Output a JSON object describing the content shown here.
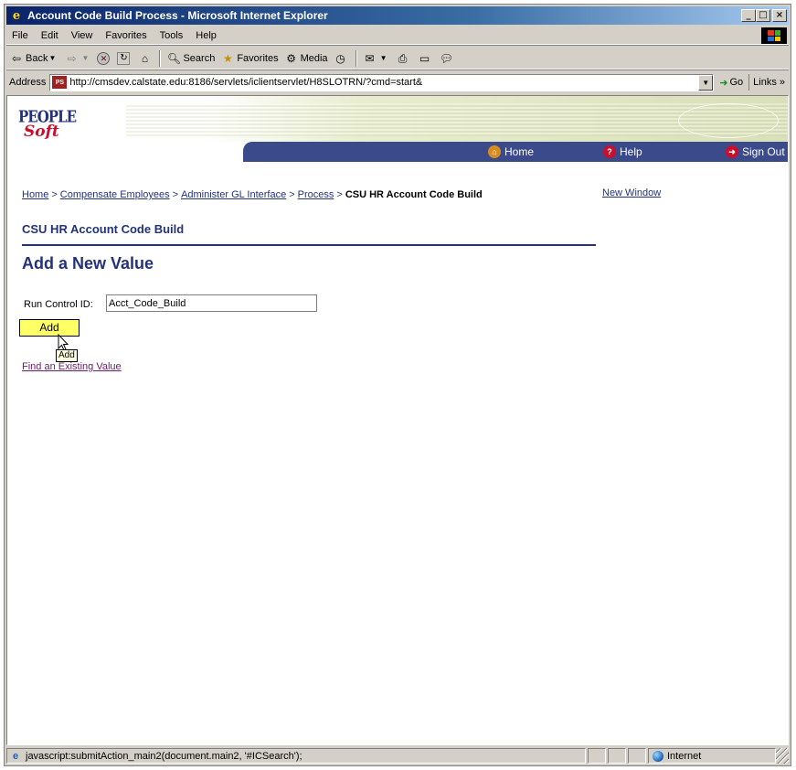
{
  "window": {
    "title": "Account Code Build Process - Microsoft Internet Explorer",
    "controls": {
      "minimize": "_",
      "maximize": "□",
      "close": "×"
    }
  },
  "menu": {
    "items": [
      "File",
      "Edit",
      "View",
      "Favorites",
      "Tools",
      "Help"
    ]
  },
  "toolbar": {
    "back_label": "Back",
    "search_label": "Search",
    "favorites_label": "Favorites",
    "media_label": "Media"
  },
  "address": {
    "label": "Address",
    "url": "http://cmsdev.calstate.edu:8186/servlets/iclientservlet/H8SLOTRN/?cmd=start&",
    "go_label": "Go",
    "links_label": "Links »"
  },
  "header": {
    "logo_top": "PEOPLE",
    "logo_bottom": "Soft",
    "nav": {
      "home": "Home",
      "help": "Help",
      "signout": "Sign Out"
    }
  },
  "breadcrumb": {
    "items": [
      "Home",
      "Compensate Employees",
      "Administer GL Interface",
      "Process"
    ],
    "separator": ">",
    "current": "CSU HR Account Code Build"
  },
  "new_window_label": "New Window",
  "page_title": "CSU HR Account Code Build",
  "section_title": "Add a New Value",
  "form": {
    "run_control_label": "Run Control ID:",
    "run_control_value": "Acct_Code_Build",
    "add_label": "Add",
    "tooltip": "Add"
  },
  "find_existing_label": "Find an Existing Value",
  "status": {
    "text": "javascript:submitAction_main2(document.main2, '#ICSearch');",
    "zone": "Internet"
  }
}
